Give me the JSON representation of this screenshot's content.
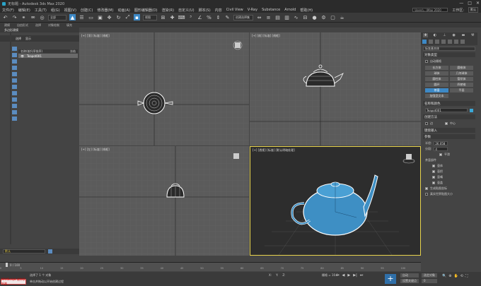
{
  "window": {
    "title": "无标题 - Autodesk 3ds Max 2020",
    "controls": [
      "—",
      "□",
      "✕"
    ]
  },
  "menu": {
    "items": [
      "文件(F)",
      "编辑(E)",
      "工具(T)",
      "组(G)",
      "视图(V)",
      "创建(C)",
      "修改器(M)",
      "动画(A)",
      "图形编辑器(D)",
      "渲染(R)",
      "自定义(U)",
      "脚本(S)",
      "内容",
      "Civil View",
      "V-Ray",
      "Substance",
      "Arnold",
      "帮助(H)"
    ],
    "search_placeholder": "Users\\...\\Max 2020",
    "workspace_label": "工作区:",
    "workspace_value": "默认"
  },
  "toolbar": {
    "filter_value": "全部",
    "viewport_value": "视图",
    "selection_set": "创建选择集"
  },
  "ribbon": {
    "tabs": [
      "建模",
      "自由形式",
      "选择",
      "对象绘制",
      "填充"
    ],
    "subtab": "多边形建模"
  },
  "scene_explorer": {
    "tabs": [
      "选择",
      "显示"
    ],
    "header": "名称(按升序排序)",
    "header_col": "冻结",
    "object": "Teapot001",
    "bottom_value": "默认"
  },
  "viewports": {
    "top": "[+] [顶] [标准] [线框]",
    "front": "[+] [前] [标准] [线框]",
    "left": "[+] [左] [标准] [线框]",
    "persp": "[+] [透视] [标准] [默认明暗处理]"
  },
  "command_panel": {
    "category": "标准基本体",
    "object_type_header": "对象类型",
    "autogrid_label": "自动栅格",
    "buttons": [
      "长方体",
      "圆锥体",
      "球体",
      "几何球体",
      "圆柱体",
      "管状体",
      "圆环",
      "四棱锥",
      "茶壶",
      "平面",
      "加强型文本"
    ],
    "active_button": "茶壶",
    "name_color_header": "名称和颜色",
    "object_name": "Teapot001",
    "color": "#3aa8d8",
    "creation_method_header": "创建方法",
    "creation_methods": [
      "边",
      "中心"
    ],
    "keyboard_header": "键盘输入",
    "params_header": "参数",
    "radius_label": "半径:",
    "radius_value": "26.058",
    "segments_label": "分段:",
    "segments_value": "4",
    "smooth_label": "平滑",
    "parts_label": "茶壶部件",
    "parts": [
      "壶体",
      "壶把",
      "壶嘴",
      "壶盖"
    ],
    "gen_coords": "生成贴图坐标",
    "real_world": "真实世界贴图大小"
  },
  "timeline": {
    "frame": "0 / 100",
    "ticks": [
      "0",
      "5",
      "10",
      "15",
      "20",
      "25",
      "30",
      "35",
      "40",
      "45",
      "50",
      "55",
      "60",
      "65",
      "70",
      "75",
      "80",
      "85",
      "90",
      "95",
      "100"
    ]
  },
  "status": {
    "maxscript": "MAXScript 迷你侦听器",
    "selection": "选择了 1 个 对象",
    "hint": "单击并拖动以开始创建过程",
    "x_label": "X:",
    "y_label": "Y:",
    "z_label": "Z:",
    "grid": "栅格 = 10.0",
    "auto_key": "自动",
    "set_key": "设置关键点",
    "key_filter": "选定对象",
    "frame_value": "0"
  }
}
